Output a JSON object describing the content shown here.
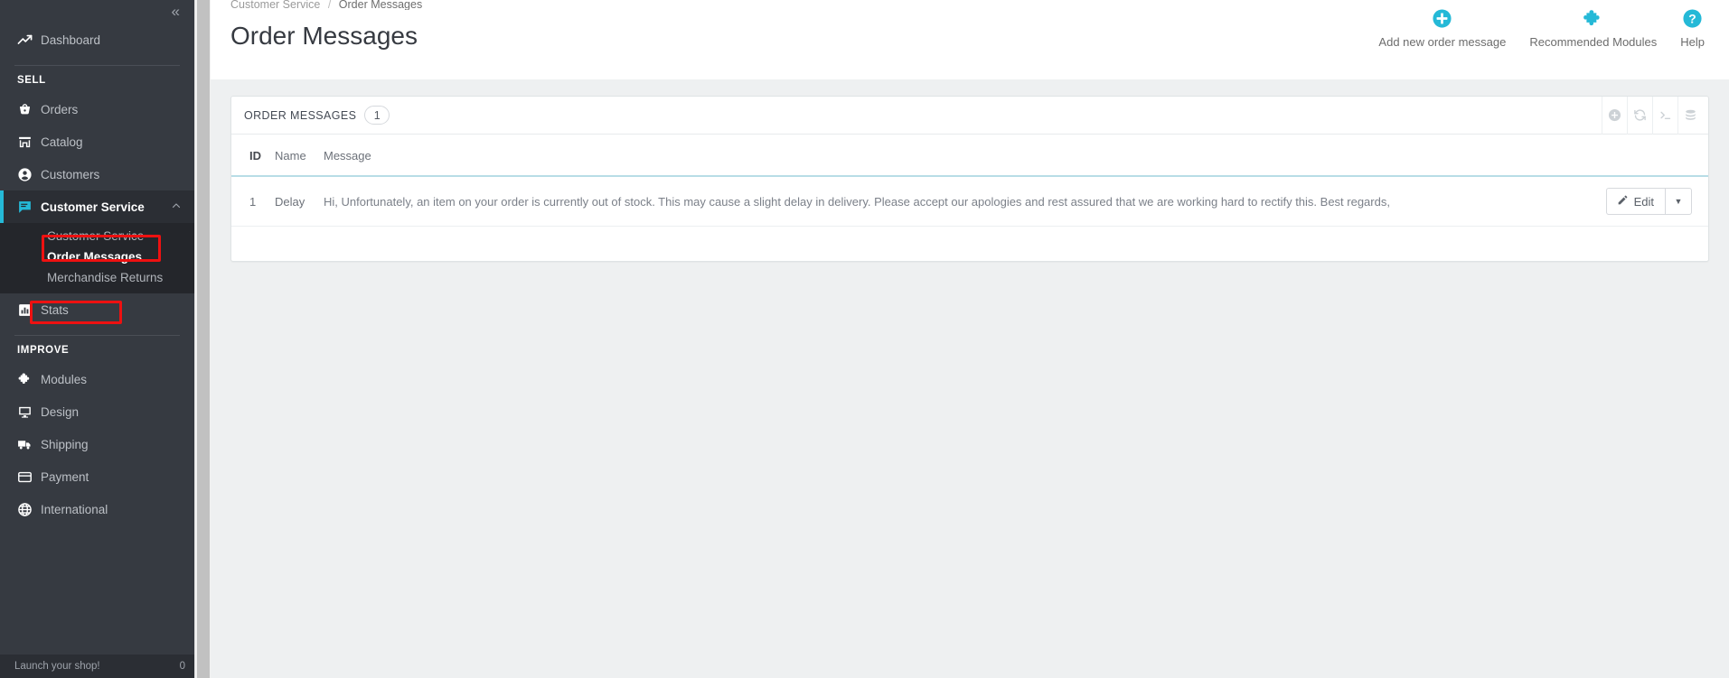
{
  "sidebar": {
    "collapse_label": "«",
    "dashboard": {
      "label": "Dashboard",
      "icon": "trend-up-icon"
    },
    "sections": [
      {
        "title": "SELL",
        "items": [
          {
            "label": "Orders",
            "icon": "basket-icon"
          },
          {
            "label": "Catalog",
            "icon": "store-icon"
          },
          {
            "label": "Customers",
            "icon": "user-circle-icon"
          },
          {
            "label": "Customer Service",
            "icon": "message-lines-icon"
          },
          {
            "label": "Stats",
            "icon": "bar-chart-icon"
          }
        ]
      },
      {
        "title": "IMPROVE",
        "items": [
          {
            "label": "Modules",
            "icon": "puzzle-icon"
          },
          {
            "label": "Design",
            "icon": "monitor-icon"
          },
          {
            "label": "Shipping",
            "icon": "truck-icon"
          },
          {
            "label": "Payment",
            "icon": "credit-card-icon"
          },
          {
            "label": "International",
            "icon": "globe-icon"
          }
        ]
      }
    ],
    "submenu": [
      {
        "label": "Customer Service",
        "active": false
      },
      {
        "label": "Order Messages",
        "active": true
      },
      {
        "label": "Merchandise Returns",
        "active": false
      }
    ],
    "chevron_up": "⌃",
    "footer": {
      "label": "Launch your shop!",
      "count": "0"
    },
    "accent_color": "#25b9d7",
    "bg_color": "#363a41",
    "submenu_bg_color": "#24262b",
    "annotation_color": "#ee1111"
  },
  "breadcrumb": {
    "parent": "Customer Service",
    "separator": "/",
    "current": "Order Messages"
  },
  "page": {
    "title": "Order Messages"
  },
  "toolbar": {
    "buttons": [
      {
        "label": "Add new order message",
        "icon": "plus-circle-icon"
      },
      {
        "label": "Recommended Modules",
        "icon": "puzzle-icon"
      },
      {
        "label": "Help",
        "icon": "question-circle-icon"
      }
    ]
  },
  "panel": {
    "title": "ORDER MESSAGES",
    "count": "1",
    "actions": [
      {
        "icon": "plus-circle-icon",
        "name": "add-icon"
      },
      {
        "icon": "refresh-icon",
        "name": "refresh-icon"
      },
      {
        "icon": "terminal-icon",
        "name": "terminal-icon"
      },
      {
        "icon": "database-icon",
        "name": "database-icon"
      }
    ]
  },
  "table": {
    "columns": [
      "ID",
      "Name",
      "Message",
      ""
    ],
    "rows": [
      {
        "id": "1",
        "name": "Delay",
        "message": "Hi, Unfortunately, an item on your order is currently out of stock. This may cause a slight delay in delivery. Please accept our apologies and rest assured that we are working hard to rectify this. Best regards,",
        "edit_label": "Edit",
        "caret": "▼"
      }
    ]
  }
}
